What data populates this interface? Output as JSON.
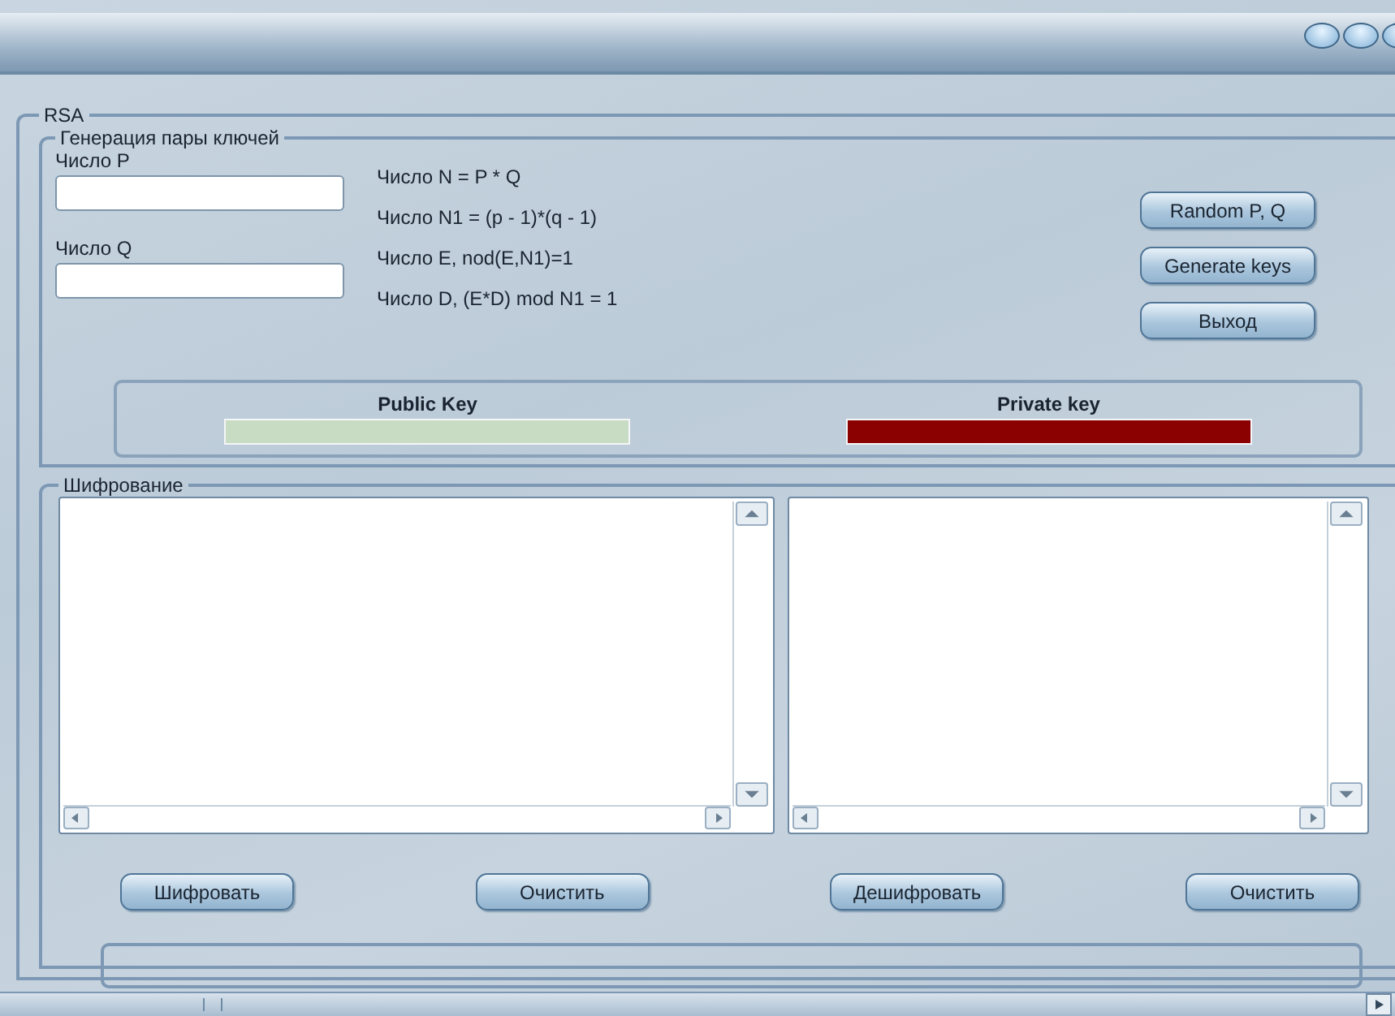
{
  "main_group": {
    "title": "RSA"
  },
  "key_generation": {
    "title": "Генерация пары ключей",
    "fields": [
      {
        "label": "Число P"
      },
      {
        "label": "Число Q"
      }
    ],
    "formulas": [
      "Число N = P * Q",
      "Число N1 =  (p - 1)*(q - 1)",
      "Число E, nod(E,N1)=1",
      "Число D, (E*D) mod N1 = 1"
    ],
    "buttons": [
      "Random P, Q",
      "Generate keys",
      "Выход"
    ],
    "keys": [
      {
        "label": "Public Key",
        "color": "#c8dcc4"
      },
      {
        "label": "Private key",
        "color": "#8b0000"
      }
    ]
  },
  "encryption": {
    "title": "Шифрование",
    "buttons": [
      "Шифровать",
      "Очистить",
      "Дешифровать",
      "Очистить"
    ]
  }
}
